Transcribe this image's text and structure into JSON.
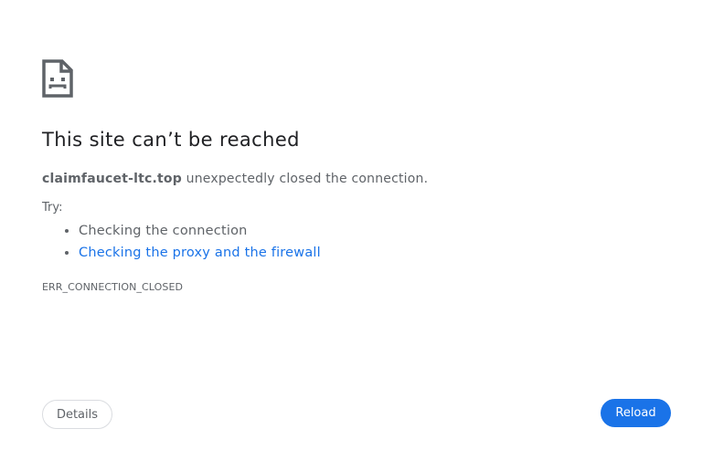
{
  "icon": "sad-page-icon",
  "title": "This site can’t be reached",
  "summary": {
    "host": "claimfaucet-ltc.top",
    "message": " unexpectedly closed the connection."
  },
  "try_label": "Try:",
  "suggestions": [
    {
      "label": "Checking the connection",
      "is_link": false
    },
    {
      "label": "Checking the proxy and the firewall",
      "is_link": true
    }
  ],
  "error_code": "ERR_CONNECTION_CLOSED",
  "buttons": {
    "details": "Details",
    "reload": "Reload"
  },
  "colors": {
    "title": "#202124",
    "text": "#5f6368",
    "link": "#1a73e8",
    "reload_bg": "#1a73e8"
  }
}
